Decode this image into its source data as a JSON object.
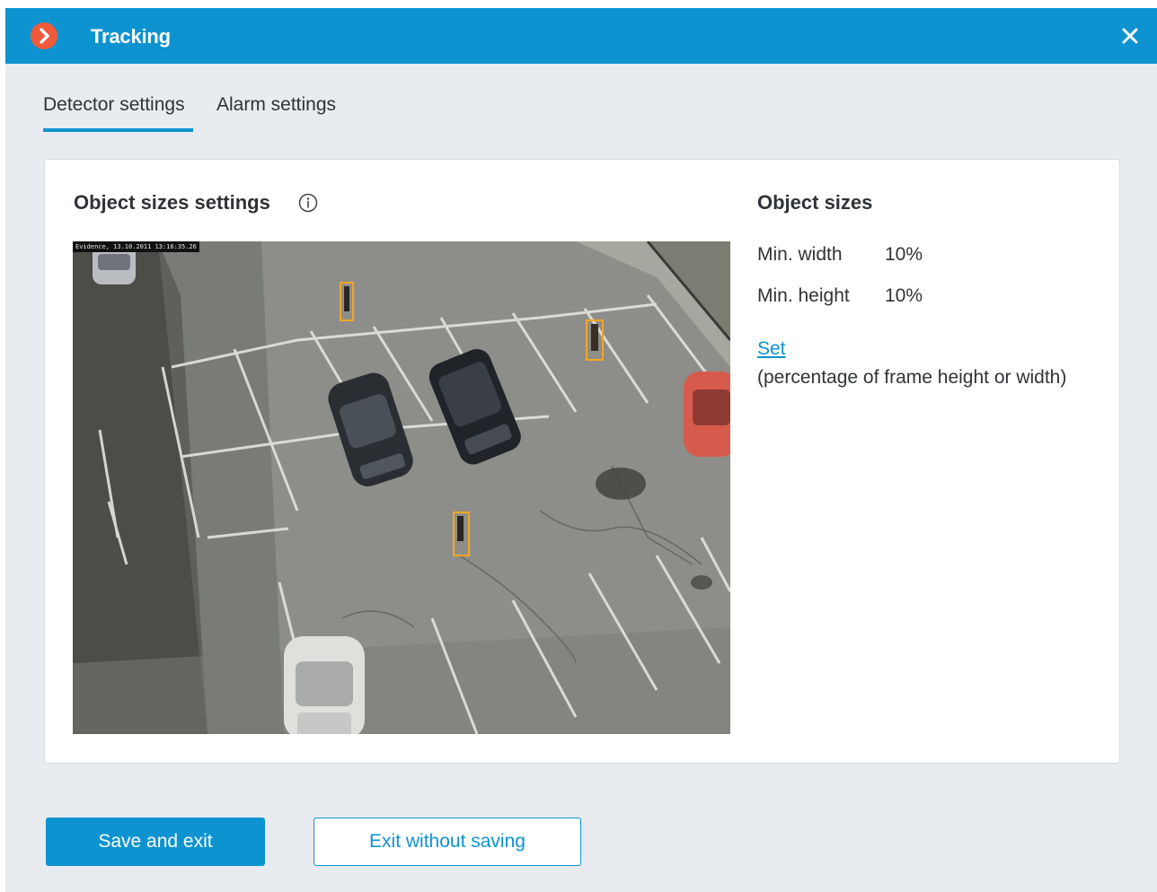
{
  "window": {
    "title": "Tracking",
    "accent_color": "#0e93d1",
    "app_icon": "chevron-right-icon",
    "close_icon": "close-icon"
  },
  "tabs": [
    {
      "label": "Detector settings",
      "active": true
    },
    {
      "label": "Alarm settings",
      "active": false
    }
  ],
  "object_sizes_settings": {
    "title": "Object sizes settings",
    "info_icon": "info-icon",
    "video_timestamp": "Evidence, 13.10.2011 13:16:35.26"
  },
  "object_sizes": {
    "title": "Object sizes",
    "min_width_label": "Min. width",
    "min_width_value": "10%",
    "min_height_label": "Min. height",
    "min_height_value": "10%",
    "set_link": "Set",
    "hint": "(percentage of frame height or width)"
  },
  "buttons": {
    "save_label": "Save and exit",
    "exit_label": "Exit without saving"
  }
}
